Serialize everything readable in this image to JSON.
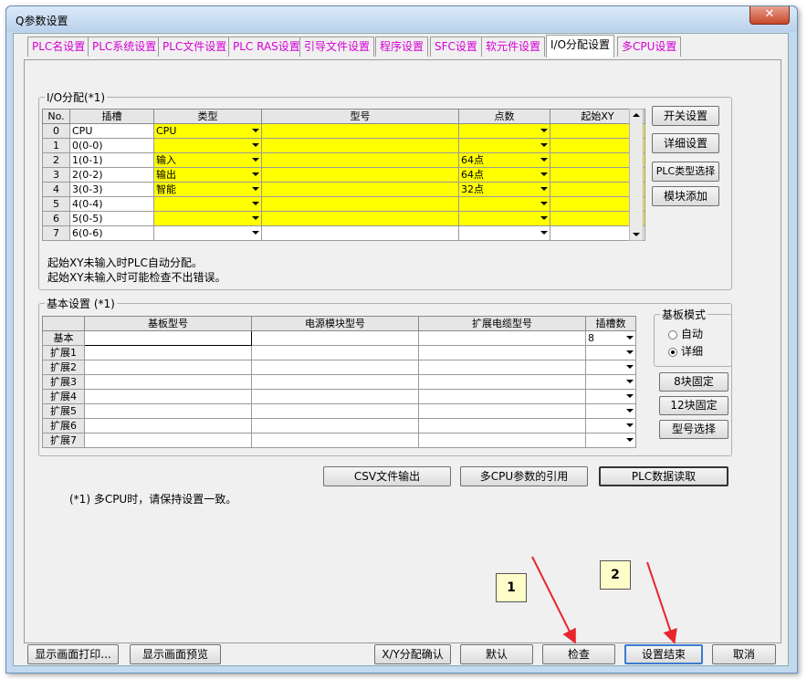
{
  "window": {
    "title": "Q参数设置",
    "close_label": "✕"
  },
  "tabs": [
    "PLC名设置",
    "PLC系统设置",
    "PLC文件设置",
    "PLC RAS设置",
    "引导文件设置",
    "程序设置",
    "SFC设置",
    "软元件设置",
    "I/O分配设置",
    "多CPU设置"
  ],
  "io": {
    "group_label": "I/O分配(*1)",
    "headers": [
      "No.",
      "插槽",
      "类型",
      "型号",
      "点数",
      "起始XY"
    ],
    "rows": [
      {
        "no": "0",
        "slot": "CPU",
        "type": "CPU",
        "model": "",
        "points": "",
        "start": ""
      },
      {
        "no": "1",
        "slot": "0(0-0)",
        "type": "",
        "model": "",
        "points": "",
        "start": ""
      },
      {
        "no": "2",
        "slot": "1(0-1)",
        "type": "输入",
        "model": "",
        "points": "64点",
        "start": ""
      },
      {
        "no": "3",
        "slot": "2(0-2)",
        "type": "输出",
        "model": "",
        "points": "64点",
        "start": ""
      },
      {
        "no": "4",
        "slot": "3(0-3)",
        "type": "智能",
        "model": "",
        "points": "32点",
        "start": ""
      },
      {
        "no": "5",
        "slot": "4(0-4)",
        "type": "",
        "model": "",
        "points": "",
        "start": ""
      },
      {
        "no": "6",
        "slot": "5(0-5)",
        "type": "",
        "model": "",
        "points": "",
        "start": ""
      },
      {
        "no": "7",
        "slot": "6(0-6)",
        "type": "",
        "model": "",
        "points": "",
        "start": ""
      }
    ],
    "side_buttons": [
      "开关设置",
      "详细设置",
      "PLC类型选择",
      "模块添加"
    ],
    "notes": [
      "起始XY未输入时PLC自动分配。",
      "起始XY未输入时可能检查不出错误。"
    ]
  },
  "base": {
    "group_label": "基本设置 (*1)",
    "headers": [
      "",
      "基板型号",
      "电源模块型号",
      "扩展电缆型号",
      "插槽数"
    ],
    "rows": [
      {
        "name": "基本",
        "slots": "8"
      },
      {
        "name": "扩展1",
        "slots": ""
      },
      {
        "name": "扩展2",
        "slots": ""
      },
      {
        "name": "扩展3",
        "slots": ""
      },
      {
        "name": "扩展4",
        "slots": ""
      },
      {
        "name": "扩展5",
        "slots": ""
      },
      {
        "name": "扩展6",
        "slots": ""
      },
      {
        "name": "扩展7",
        "slots": ""
      }
    ],
    "mode_label": "基板模式",
    "mode_auto": "自动",
    "mode_detail": "详细",
    "mode_selected": "详细",
    "mode_buttons": [
      "8块固定",
      "12块固定",
      "型号选择"
    ]
  },
  "mid_buttons": [
    "CSV文件输出",
    "多CPU参数的引用",
    "PLC数据读取"
  ],
  "multi_cpu_note": "(*1) 多CPU时，请保持设置一致。",
  "bottom_buttons": [
    "显示画面打印...",
    "显示画面预览",
    "X/Y分配确认",
    "默认",
    "检查",
    "设置结束",
    "取消"
  ],
  "callouts": [
    "1",
    "2"
  ],
  "arrow_color": "#e8252d",
  "highlight_color": "#ffff00"
}
